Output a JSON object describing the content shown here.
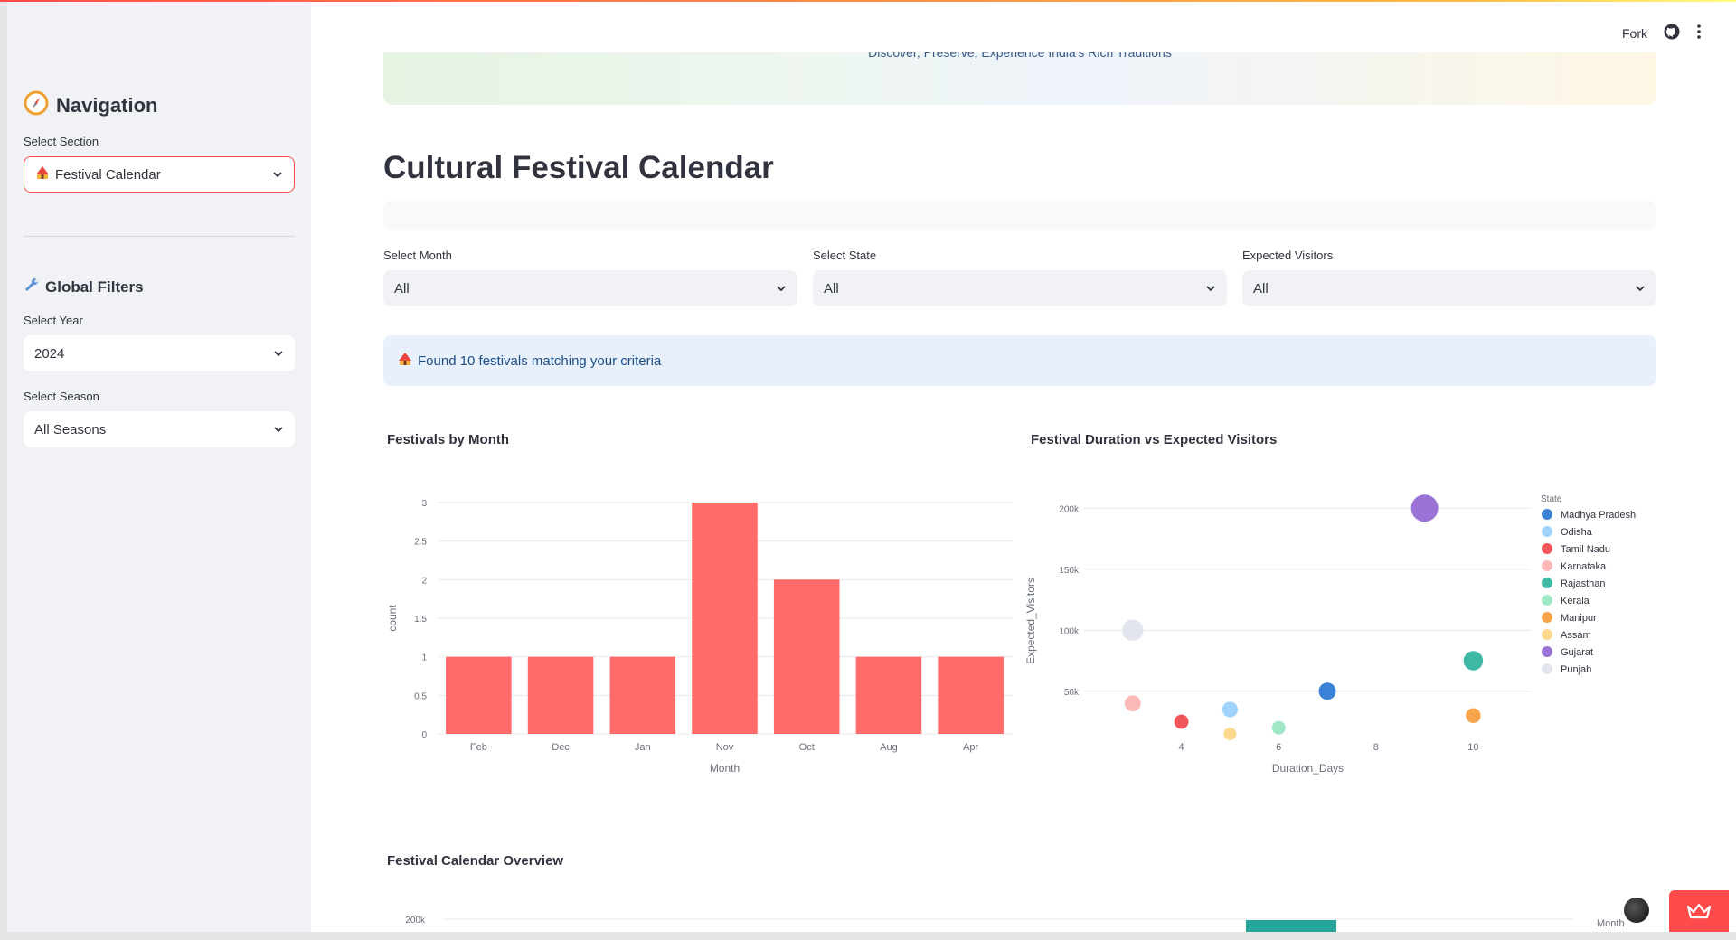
{
  "sidebar": {
    "title": "Navigation",
    "section_label": "Select Section",
    "section_value": "Festival Calendar",
    "filters_title": "Global Filters",
    "year_label": "Select Year",
    "year_value": "2024",
    "season_label": "Select Season",
    "season_value": "All Seasons"
  },
  "header": {
    "fork_label": "Fork"
  },
  "banner": {
    "text": "Discover, Preserve, Experience India's Rich Traditions"
  },
  "page": {
    "title": "Cultural Festival Calendar",
    "month_label": "Select Month",
    "month_value": "All",
    "state_label": "Select State",
    "state_value": "All",
    "visitors_label": "Expected Visitors",
    "visitors_value": "All",
    "info_text": "Found 10 festivals matching your criteria"
  },
  "colors": {
    "accent": "#ff4b4b",
    "bar": "#ff6b6b"
  },
  "chart_data": [
    {
      "type": "bar",
      "title": "Festivals by Month",
      "xlabel": "Month",
      "ylabel": "count",
      "categories": [
        "Feb",
        "Dec",
        "Jan",
        "Nov",
        "Oct",
        "Aug",
        "Apr"
      ],
      "values": [
        1,
        1,
        1,
        3,
        2,
        1,
        1
      ],
      "ylim": [
        0,
        3
      ],
      "yticks": [
        "0",
        "0.5",
        "1",
        "1.5",
        "2",
        "2.5",
        "3"
      ],
      "grid": true
    },
    {
      "type": "scatter",
      "title": "Festival Duration vs Expected Visitors",
      "xlabel": "Duration_Days",
      "ylabel": "Expected_Visitors",
      "legend_title": "State",
      "legend_position": "right",
      "xticks": [
        "4",
        "6",
        "8",
        "10"
      ],
      "yticks": [
        "50k",
        "100k",
        "150k",
        "200k"
      ],
      "xlim": [
        2,
        11.2
      ],
      "ylim": [
        15000,
        215000
      ],
      "series": [
        {
          "name": "Madhya Pradesh",
          "color": "#3b82d6",
          "x": 7,
          "y": 50000
        },
        {
          "name": "Odisha",
          "color": "#9fd3fb",
          "x": 5,
          "y": 35000
        },
        {
          "name": "Tamil Nadu",
          "color": "#f0565a",
          "x": 4,
          "y": 25000
        },
        {
          "name": "Karnataka",
          "color": "#fcb8b8",
          "x": 3,
          "y": 40000
        },
        {
          "name": "Rajasthan",
          "color": "#3fb8a4",
          "x": 10,
          "y": 75000
        },
        {
          "name": "Kerala",
          "color": "#9fe8c6",
          "x": 6,
          "y": 20000
        },
        {
          "name": "Manipur",
          "color": "#f7a44a",
          "x": 10,
          "y": 30000
        },
        {
          "name": "Assam",
          "color": "#fdd98f",
          "x": 5,
          "y": 15000
        },
        {
          "name": "Gujarat",
          "color": "#9b72d6",
          "x": 9,
          "y": 200000
        },
        {
          "name": "Punjab",
          "color": "#e3e5ee",
          "x": 3,
          "y": 100000
        }
      ]
    },
    {
      "type": "bar",
      "title": "Festival Calendar Overview",
      "legend_title": "Month",
      "yticks": [
        "200k"
      ]
    }
  ]
}
